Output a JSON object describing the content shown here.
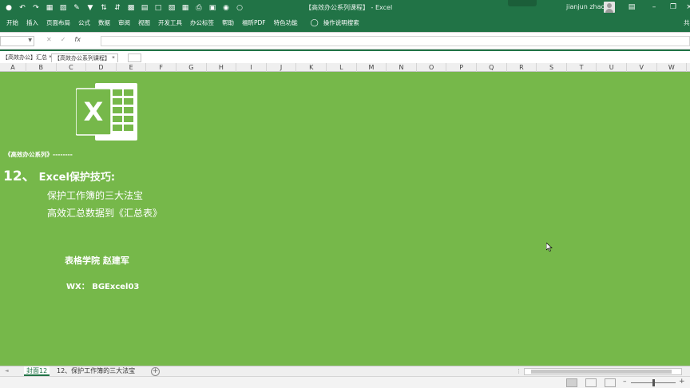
{
  "window": {
    "title": "【高效办公系列课程】 - Excel",
    "user": "jianjun zhao",
    "controls": [
      "minimize",
      "restore",
      "close"
    ]
  },
  "quick_access": [
    "save-icon",
    "undo-icon",
    "redo-icon",
    "print-icon",
    "screenshot-icon"
  ],
  "ribbon": {
    "tabs": [
      "开始",
      "插入",
      "页面布局",
      "公式",
      "数据",
      "审阅",
      "视图",
      "开发工具",
      "办公标签",
      "帮助",
      "福昕PDF",
      "特色功能"
    ],
    "search": "操作说明搜索",
    "share": "共"
  },
  "formula_bar": {
    "name_box": "",
    "formula": "",
    "fx": "fx"
  },
  "workbook_tabs": [
    {
      "label": "【高效办公】汇总 *",
      "active": false
    },
    {
      "label": "【高效办公系列课程】 *",
      "active": true
    }
  ],
  "columns": [
    "A",
    "B",
    "C",
    "D",
    "E",
    "F",
    "G",
    "H",
    "I",
    "J",
    "K",
    "L",
    "M",
    "N",
    "O",
    "P",
    "Q",
    "R",
    "S",
    "T",
    "U",
    "V",
    "W"
  ],
  "sheet": {
    "series_label": "《高效办公系列》--------",
    "title_num": "12、",
    "title_text": "Excel保护技巧:",
    "lines": [
      "保护工作簿的三大法宝",
      "高效汇总数据到《汇总表》"
    ],
    "author": "表格学院 赵建军",
    "wx": "WX： BGExcel03",
    "logo_letter": "X",
    "background": "#76b84a"
  },
  "sheet_tabs": [
    {
      "label": "封面12",
      "active": true
    },
    {
      "label": "12、保护工作簿的三大法宝",
      "active": false
    }
  ],
  "status": {
    "views": [
      "normal",
      "page-layout",
      "page-break"
    ],
    "zoom_level": 0.5
  }
}
